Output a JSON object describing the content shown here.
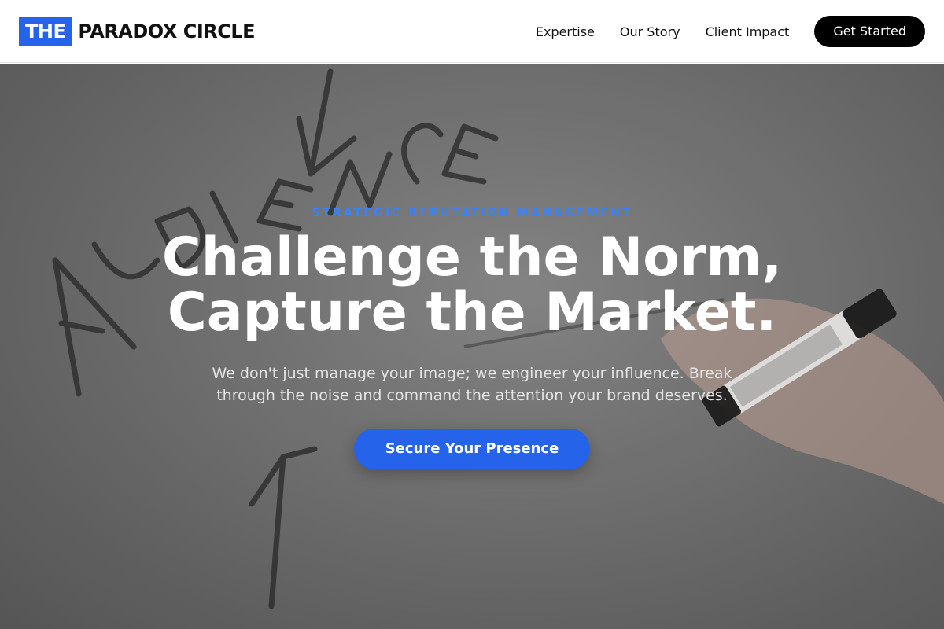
{
  "header": {
    "logo_box": "THE",
    "logo_text": "PARADOX CIRCLE",
    "nav": [
      "Expertise",
      "Our Story",
      "Client Impact"
    ],
    "cta": "Get Started"
  },
  "hero": {
    "eyebrow": "STRATEGIC REPUTATION MANAGEMENT",
    "headline_line1": "Challenge the Norm,",
    "headline_line2": "Capture the Market.",
    "subtext": "We don't just manage your image; we engineer your influence. Break through the noise and command the attention your brand deserves.",
    "cta": "Secure Your Presence",
    "background_description": "",
    "accent_color": "#2563eb"
  }
}
